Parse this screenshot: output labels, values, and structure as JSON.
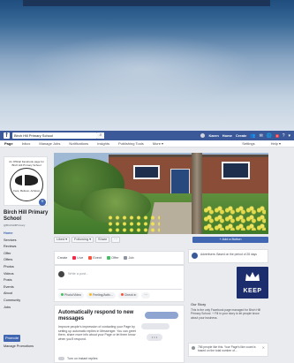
{
  "browser": {
    "search_value": "Birch Hill Primary School",
    "logo": "f",
    "search_icon": "⌕",
    "user_name": "Karen",
    "home": "Home",
    "create": "Create",
    "notif_badge": "9",
    "icons": [
      "friends-icon",
      "messages-icon",
      "notifications-icon",
      "help-icon",
      "menu-icon"
    ]
  },
  "page_nav": {
    "tabs": [
      "Page",
      "Inbox",
      "Manage Jobs",
      "Notifications",
      "Insights",
      "Publishing Tools",
      "More ▾"
    ],
    "right": [
      "Settings",
      "Help ▾"
    ]
  },
  "profile": {
    "caption": "An Official Facebook page for Birch Hill Primary School",
    "motto": "Care, Believe, Achieve",
    "name": "Birch Hill Primary School",
    "handle": "@BirchHillPrimary"
  },
  "left_nav": [
    "Home",
    "Services",
    "Reviews",
    "Offer",
    "Offers",
    "Photos",
    "Videos",
    "Posts",
    "Events",
    "About",
    "Community",
    "Jobs"
  ],
  "left_nav_active": 0,
  "promote_label": "Promote",
  "manage_promotions": "Manage Promotions",
  "actions": {
    "liked": "Liked ▾",
    "following": "Following ▾",
    "share": "Share",
    "more": "···",
    "add_button": "+ Add a Button"
  },
  "composer": {
    "tabs": [
      "Create",
      "Live",
      "Event",
      "Offer",
      "Job"
    ],
    "placeholder": "Write a post...",
    "chips": [
      "Photo/Video",
      "Feeling/Activ...",
      "Check in",
      "···"
    ]
  },
  "auto_response": {
    "title": "Automatically respond to new messages",
    "body": "Improve people's impression of contacting your Page by setting up automatic replies in Messenger. You can greet them, share more info about your Page or let them know when you'll respond.",
    "chat_bubble": "• • •",
    "toggle_label": "Turn on instant replies"
  },
  "sidebar": {
    "ad_text": "Advertisers: Based on the period of 28 days",
    "keep_label": "KEEP",
    "our_story_heading": "Our Story",
    "our_story_text": "This is the only Facebook page managed for Birch Hill Primary School. + Fill in your story to let people know about your business.",
    "info_text": "756 people like this. Your Page's like count is based on the total number of...",
    "info_close": "✕"
  },
  "colors": {
    "fb_blue": "#3b5998",
    "button_blue": "#4267b2",
    "page_bg": "#e9ebee"
  }
}
